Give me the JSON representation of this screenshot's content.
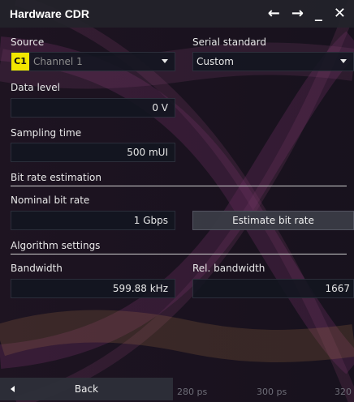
{
  "window": {
    "title": "Hardware CDR",
    "controls": {
      "back": "←",
      "forward": "→",
      "minimize": "_",
      "close": "✕"
    }
  },
  "source": {
    "label": "Source",
    "channel_badge": "C1",
    "channel_name": "Channel 1",
    "channel_color": "#f2e600"
  },
  "serial_standard": {
    "label": "Serial standard",
    "value": "Custom"
  },
  "data_level": {
    "label": "Data level",
    "value": "0 V"
  },
  "sampling_time": {
    "label": "Sampling time",
    "value": "500 mUI"
  },
  "bit_rate_estimation": {
    "section_label": "Bit rate estimation",
    "nominal_label": "Nominal bit rate",
    "nominal_value": "1 Gbps",
    "estimate_button": "Estimate bit rate"
  },
  "algorithm_settings": {
    "section_label": "Algorithm settings",
    "bandwidth_label": "Bandwidth",
    "bandwidth_value": "599.88 kHz",
    "rel_bandwidth_label": "Rel. bandwidth",
    "rel_bandwidth_value": "1667"
  },
  "footer": {
    "back_label": "Back",
    "axis_ticks": [
      "280 ps",
      "300 ps",
      "320"
    ]
  }
}
